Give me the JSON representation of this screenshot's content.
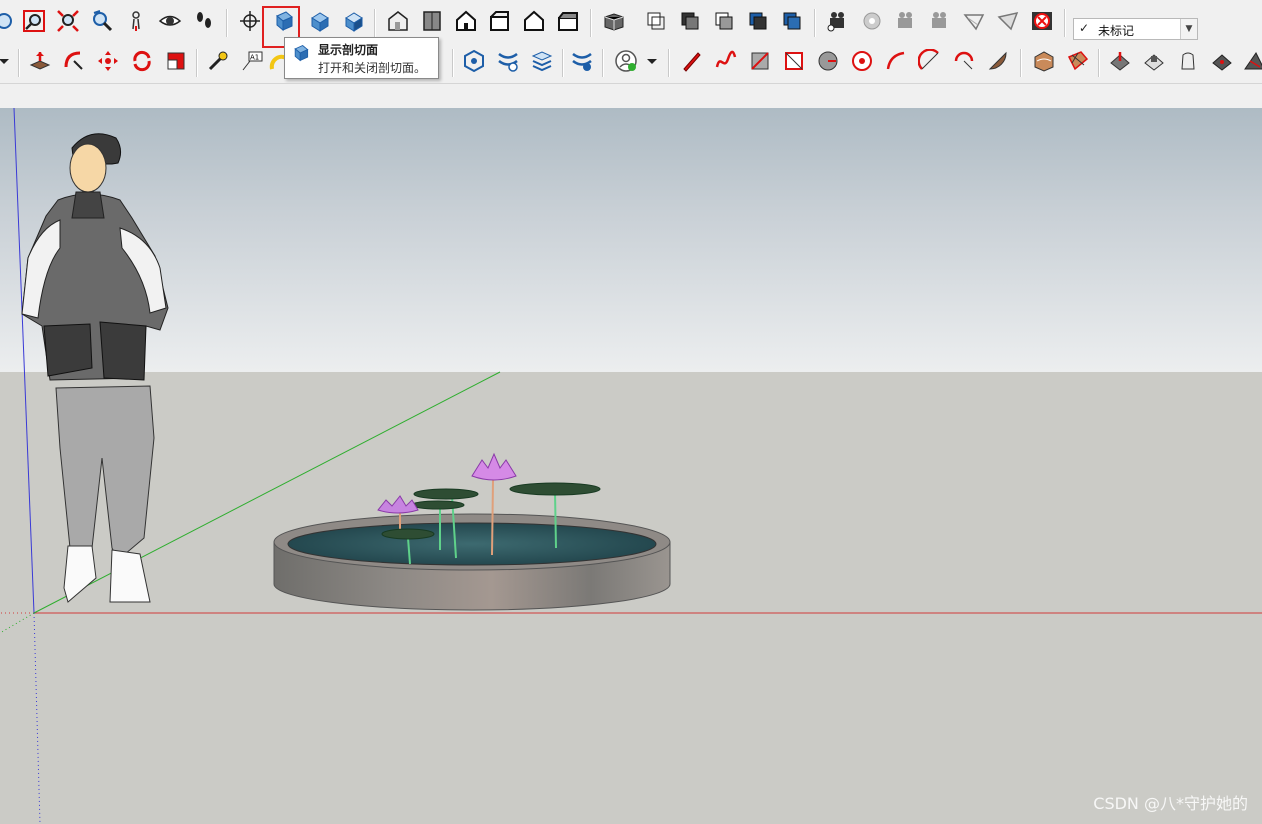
{
  "toolbar": {
    "row1_icons": [
      "circle-select-icon",
      "zoom-window-icon",
      "zoom-extents-icon",
      "previous-view-icon",
      "position-camera-icon",
      "look-around-icon",
      "walk-icon",
      "axes-icon",
      "display-section-planes-icon",
      "display-section-cuts-icon",
      "display-section-fill-icon",
      "iso-view-icon",
      "top-view-icon",
      "front-view-icon",
      "right-view-icon",
      "back-view-icon",
      "left-view-icon",
      "xray-icon",
      "back-edges-icon",
      "wireframe-icon",
      "hidden-line-icon",
      "shaded-icon",
      "camera-add-icon",
      "camera-icon",
      "camera-play-icon",
      "camera-2-icon",
      "soften-icon",
      "smooth-icon",
      "hide-rest-icon"
    ],
    "row2_icons": [
      "push-pull-icon",
      "follow-me-icon",
      "move-icon",
      "rotate-icon",
      "scale-icon",
      "tape-measure-icon",
      "text-label-icon",
      "protractor-icon",
      "section-tool-icon",
      "styles-icon",
      "layers-icon",
      "scene-settings-icon",
      "user-account-icon",
      "pencil-icon",
      "freehand-icon",
      "rectangle-icon",
      "rotated-rectangle-icon",
      "circle-icon",
      "polygon-icon",
      "arc-icon",
      "two-point-arc-icon",
      "three-point-arc-icon",
      "pie-icon",
      "sandbox-from-contours-icon",
      "sandbox-from-scratch-icon",
      "smoove-icon",
      "stamp-icon",
      "drape-icon",
      "add-detail-icon",
      "flip-edge-icon"
    ]
  },
  "tooltip": {
    "title": "显示剖切面",
    "description": "打开和关闭剖切面。"
  },
  "tag_selector": {
    "check": "✓",
    "value": "未标记"
  },
  "watermark": "CSDN @八*守护她的",
  "colors": {
    "highlight": "#e02020",
    "axis_red": "#d23b3b",
    "axis_green": "#2fae2f",
    "axis_blue": "#3a3ad6",
    "water": "#2a4f55"
  }
}
